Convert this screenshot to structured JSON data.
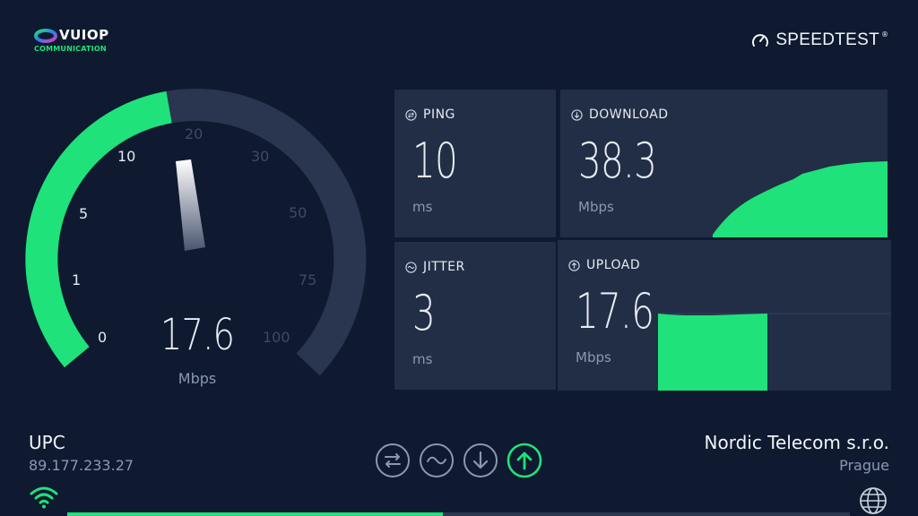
{
  "logo": {
    "name": "VUIOP",
    "subtitle": "COMMUNICATION"
  },
  "brand": {
    "name": "SPEEDTEST",
    "trademark": "®"
  },
  "gauge": {
    "value": "17.6",
    "unit": "Mbps",
    "ticks": [
      "0",
      "1",
      "5",
      "10",
      "20",
      "30",
      "50",
      "75",
      "100"
    ],
    "fill_fraction": 0.455
  },
  "ping": {
    "label": "PING",
    "value": "10",
    "unit": "ms"
  },
  "jitter": {
    "label": "JITTER",
    "value": "3",
    "unit": "ms"
  },
  "download": {
    "label": "DOWNLOAD",
    "value": "38.3",
    "unit": "Mbps"
  },
  "upload": {
    "label": "UPLOAD",
    "value": "17.6",
    "unit": "Mbps"
  },
  "isp": {
    "name": "UPC",
    "ip": "89.177.233.27"
  },
  "server": {
    "name": "Nordic Telecom s.r.o.",
    "location": "Prague"
  },
  "steps": [
    {
      "icon": "ping-icon",
      "state": "done"
    },
    {
      "icon": "jitter-icon",
      "state": "done"
    },
    {
      "icon": "download-icon",
      "state": "done"
    },
    {
      "icon": "upload-icon",
      "state": "active"
    }
  ],
  "progress": {
    "fraction": 0.48
  },
  "colors": {
    "accent": "#1fe27a",
    "background": "#0f1a30",
    "panel": "#222e45",
    "muted": "#8b98ad"
  }
}
